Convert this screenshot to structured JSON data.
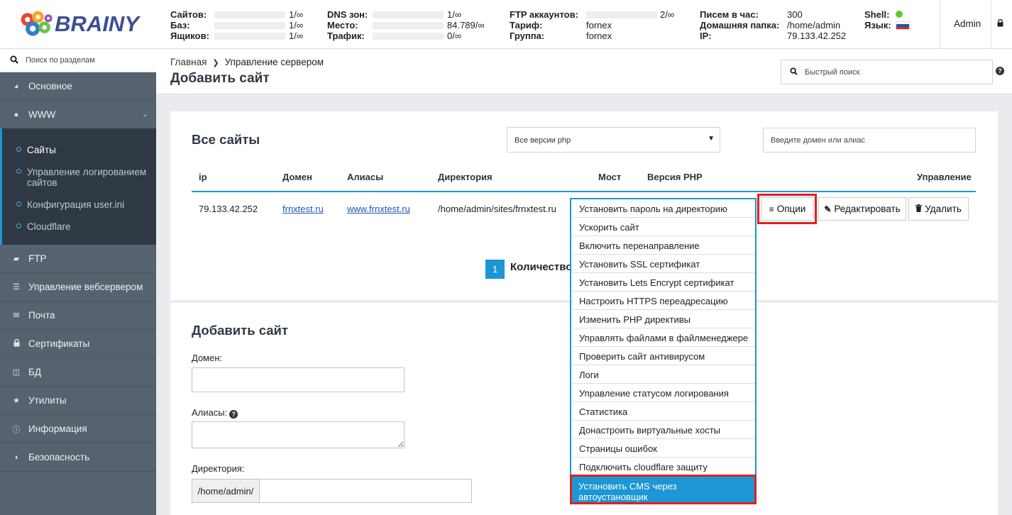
{
  "header": {
    "logo_text": "BRAINY",
    "stats_col1": [
      {
        "label": "Сайтов:",
        "value": "1/∞"
      },
      {
        "label": "Баз:",
        "value": "1/∞"
      },
      {
        "label": "Ящиков:",
        "value": "1/∞"
      }
    ],
    "stats_col2": [
      {
        "label": "DNS зон:",
        "value": "1/∞"
      },
      {
        "label": "Место:",
        "value": "84.789/∞"
      },
      {
        "label": "Трафик:",
        "value": "0/∞"
      }
    ],
    "stats_col3": [
      {
        "label": "FTP аккаунтов:",
        "value": "2/∞"
      },
      {
        "label": "Тариф:",
        "value": "fornex"
      },
      {
        "label": "Группа:",
        "value": "fornex"
      }
    ],
    "stats_col4": [
      {
        "label": "Писем в час:",
        "value": "300"
      },
      {
        "label": "Домашняя папка:",
        "value": "/home/admin"
      },
      {
        "label": "IP:",
        "value": "79.133.42.252"
      }
    ],
    "stats_col5": [
      {
        "label": "Shell:"
      },
      {
        "label": "Язык:"
      }
    ],
    "shell_status_color": "#61c93c",
    "user": "Admin"
  },
  "sidebar": {
    "search_placeholder": "Поиск по разделам",
    "items": [
      {
        "label": "Основное",
        "icon": "dashboard-icon"
      },
      {
        "label": "WWW",
        "icon": "globe-icon"
      },
      {
        "label": "FTP",
        "icon": "folder-open-icon"
      },
      {
        "label": "Управление вебсервером",
        "icon": "server-icon"
      },
      {
        "label": "Почта",
        "icon": "envelope-icon"
      },
      {
        "label": "Сертификаты",
        "icon": "lock-icon"
      },
      {
        "label": "БД",
        "icon": "database-icon"
      },
      {
        "label": "Утилиты",
        "icon": "star-icon"
      },
      {
        "label": "Информация",
        "icon": "info-icon"
      },
      {
        "label": "Безопасность",
        "icon": "shield-icon"
      }
    ],
    "www_subitems": [
      {
        "label": "Сайты",
        "active": true
      },
      {
        "label": "Управление логированием сайтов"
      },
      {
        "label": "Конфигурация user.ini"
      },
      {
        "label": "Cloudflare"
      }
    ]
  },
  "topbar": {
    "breadcrumb": [
      "Главная",
      "Управление сервером"
    ],
    "title": "Добавить сайт",
    "quick_search_placeholder": "Быстрый поиск"
  },
  "sites": {
    "title": "Все сайты",
    "php_filter": "Все версии php",
    "domain_filter_placeholder": "Введите домен или алиас",
    "columns": [
      "ip",
      "Домен",
      "Алиасы",
      "Директория",
      "Мост",
      "Версия PHP",
      "Управление"
    ],
    "rows": [
      {
        "ip": "79.133.42.252",
        "domain": "frnxtest.ru",
        "alias": "www.frnxtest.ru",
        "directory": "/home/admin/sites/frnxtest.ru"
      }
    ],
    "buttons": {
      "options": "Опции",
      "edit": "Редактировать",
      "delete": "Удалить"
    },
    "pagination": {
      "page": "1",
      "count_label": "Количество"
    }
  },
  "options_menu": [
    "Установить пароль на директорию",
    "Ускорить сайт",
    "Включить перенаправление",
    "Установить SSL сертификат",
    "Установить Lets Encrypt сертификат",
    "Настроить HTTPS переадресацию",
    "Изменить PHP директивы",
    "Управлять файлами в файлменеджере",
    "Проверить сайт антивирусом",
    "Логи",
    "Управление статусом логирования",
    "Статистика",
    "Донастроить виртуальные хосты",
    "Страницы ошибок",
    "Подключить cloudflare защиту"
  ],
  "options_menu_active": "Установить CMS через автоустановщик",
  "add_site": {
    "title": "Добавить сайт",
    "domain_label": "Домен:",
    "aliases_label": "Алиасы:",
    "directory_label": "Директория:",
    "directory_prefix": "/home/admin/"
  }
}
